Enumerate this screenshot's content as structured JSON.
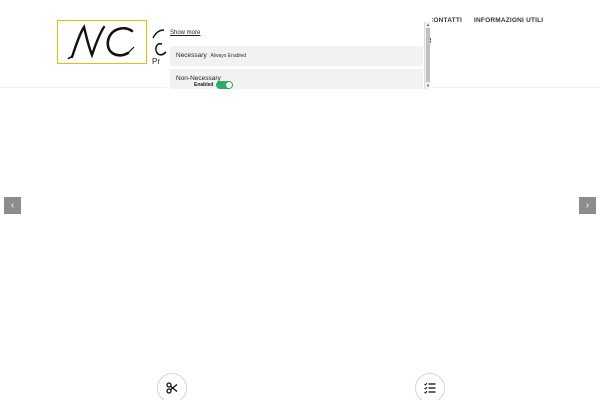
{
  "header": {
    "tagline": "Pr",
    "nav": [
      "CONTATTI",
      "INFORMAZIONI UTILI"
    ]
  },
  "cookie": {
    "show_more": "Show more",
    "categories": [
      {
        "title": "Necessary",
        "note": "Always Enabled"
      },
      {
        "title": "Non-Necessary",
        "toggle_label": "Enabled",
        "toggle_on": true
      }
    ],
    "close_icon": "close-icon"
  },
  "slider": {
    "prev_icon": "chevron-left-icon",
    "next_icon": "chevron-right-icon"
  },
  "features": [
    {
      "icon": "scissors-icon"
    },
    {
      "icon": "checklist-icon"
    }
  ],
  "colors": {
    "logo_border": "#e6c200",
    "toggle_on": "#27ae60",
    "arrow_bg": "#8c8c8c"
  }
}
